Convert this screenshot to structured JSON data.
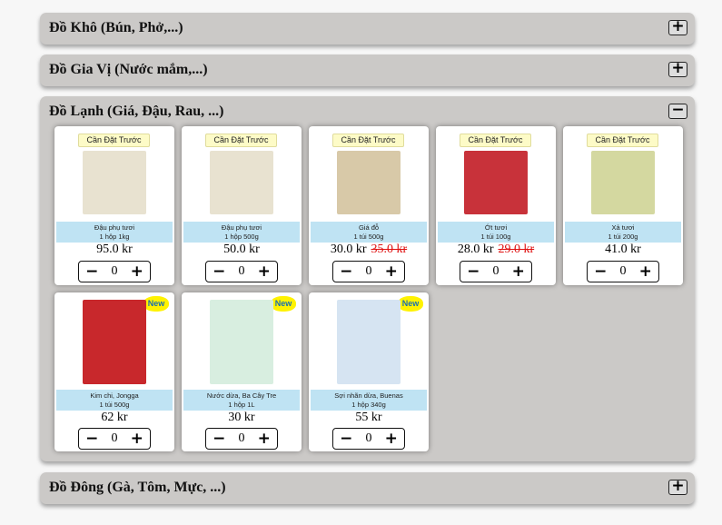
{
  "categories": [
    {
      "title": "Đồ Khô (Bún, Phở,...)",
      "toggle": "+"
    },
    {
      "title": "Đồ Gia Vị (Nước mắm,...)",
      "toggle": "+"
    },
    {
      "title": "Đồ Lạnh (Giá, Đậu, Rau, ...)",
      "toggle": "−"
    },
    {
      "title": "Đồ Đông (Gà, Tôm, Mực, ...)",
      "toggle": "+"
    }
  ],
  "stepper": {
    "minus": "−",
    "plus": "+"
  },
  "products": [
    {
      "badge": "Cần Đặt Trước",
      "name": "Đậu phụ tươi",
      "size": "1 hộp 1kg",
      "price": "95.0 kr",
      "old_price": "",
      "qty": "0",
      "img_color": "#e8e2d0"
    },
    {
      "badge": "Cần Đặt Trước",
      "name": "Đậu phụ tươi",
      "size": "1 hộp 500g",
      "price": "50.0 kr",
      "old_price": "",
      "qty": "0",
      "img_color": "#e8e2d0"
    },
    {
      "badge": "Cần Đặt Trước",
      "name": "Giá đỗ",
      "size": "1 túi 500g",
      "price": "30.0 kr",
      "old_price": "35.0 kr",
      "qty": "0",
      "img_color": "#d8c9a8"
    },
    {
      "badge": "Cần Đặt Trước",
      "name": "Ớt tươi",
      "size": "1 túi 100g",
      "price": "28.0 kr",
      "old_price": "29.0 kr",
      "qty": "0",
      "img_color": "#c8323a"
    },
    {
      "badge": "Cần Đặt Trước",
      "name": "Xả tươi",
      "size": "1 túi 200g",
      "price": "41.0 kr",
      "old_price": "",
      "qty": "0",
      "img_color": "#d4d8a0"
    },
    {
      "badge": "New",
      "name": "Kim chi, Jongga",
      "size": "1 túi 500g",
      "price": "62 kr",
      "old_price": "",
      "qty": "0",
      "img_color": "#c8282c"
    },
    {
      "badge": "New",
      "name": "Nước dừa, Ba Cây Tre",
      "size": "1 hộp 1L",
      "price": "30 kr",
      "old_price": "",
      "qty": "0",
      "img_color": "#d8eee0"
    },
    {
      "badge": "New",
      "name": "Sợi nhãn dừa, Buenas",
      "size": "1 hộp 340g",
      "price": "55 kr",
      "old_price": "",
      "qty": "0",
      "img_color": "#d6e4f2"
    }
  ]
}
